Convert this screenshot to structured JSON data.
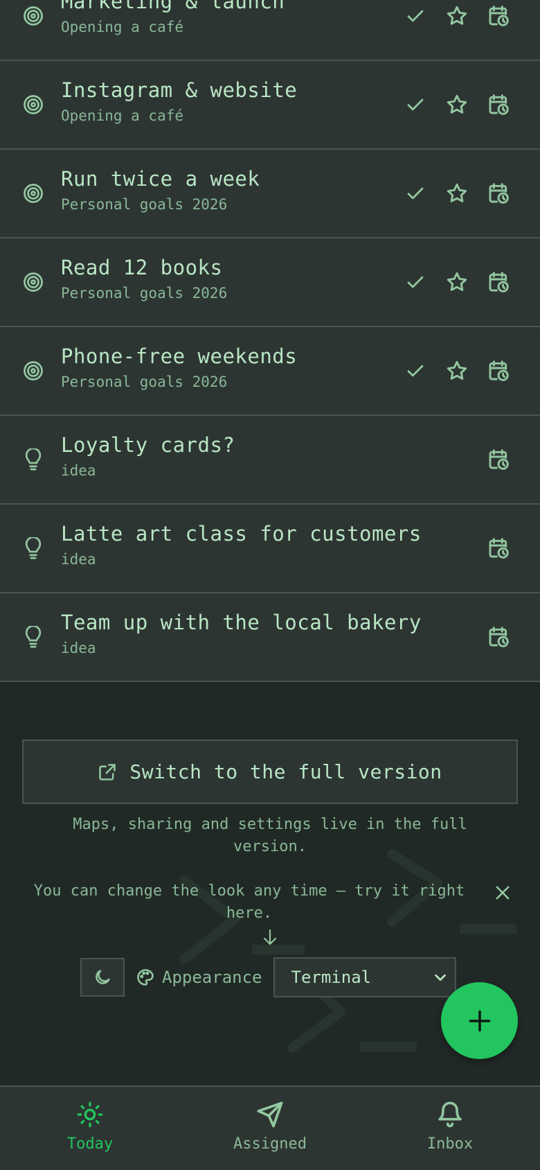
{
  "rows": [
    {
      "type": "goal",
      "title": "Marketing & launch",
      "subtitle": "Opening a café"
    },
    {
      "type": "goal",
      "title": "Instagram & website",
      "subtitle": "Opening a café"
    },
    {
      "type": "goal",
      "title": "Run twice a week",
      "subtitle": "Personal goals 2026"
    },
    {
      "type": "goal",
      "title": "Read 12 books",
      "subtitle": "Personal goals 2026"
    },
    {
      "type": "goal",
      "title": "Phone-free weekends",
      "subtitle": "Personal goals 2026"
    },
    {
      "type": "idea",
      "title": "Loyalty cards?",
      "subtitle": "idea"
    },
    {
      "type": "idea",
      "title": "Latte art class for customers",
      "subtitle": "idea"
    },
    {
      "type": "idea",
      "title": "Team up with the local bakery",
      "subtitle": "idea"
    }
  ],
  "switch_button": {
    "label": "Switch to the full version",
    "icon": "external-link-icon"
  },
  "hints": {
    "full_version": "Maps, sharing and settings live in the full version.",
    "appearance": "You can change the look any time — try it right here."
  },
  "appearance": {
    "label": "Appearance",
    "selected_theme": "Terminal"
  },
  "tabs": [
    {
      "label": "Today",
      "icon": "sun-icon",
      "active": true
    },
    {
      "label": "Assigned",
      "icon": "send-icon",
      "active": false
    },
    {
      "label": "Inbox",
      "icon": "bell-icon",
      "active": false
    }
  ],
  "colors": {
    "accent": "#22c55e",
    "background": "#212926",
    "surface": "#2d3533",
    "text": "#b9e6c3"
  }
}
